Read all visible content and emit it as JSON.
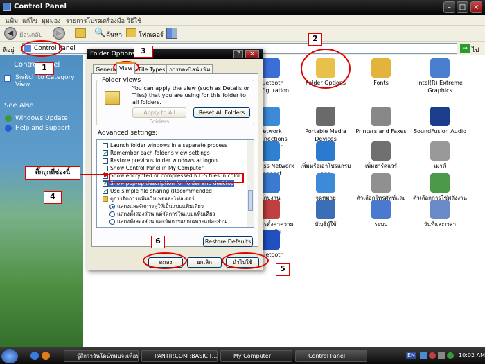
{
  "window": {
    "title": "Control Panel"
  },
  "menu": [
    "แฟ้ม",
    "แก้ไข",
    "มุมมอง",
    "รายการโปรด",
    "เครื่องมือ",
    "วิธีใช้"
  ],
  "toolbar": {
    "back": "ย้อนกลับ",
    "search": "ค้นหา",
    "folders": "โฟลเดอร์"
  },
  "address": {
    "label": "ที่อยู่",
    "value": "Control Panel",
    "go": "ไป"
  },
  "sidebar": {
    "panel_title": "Control Panel",
    "switch_view": "Switch to Category View",
    "see_also": "See Also",
    "links": [
      "Windows Update",
      "Help and Support"
    ]
  },
  "items": [
    {
      "label": "Bluetooth Configuration",
      "color": "#3a6fd8"
    },
    {
      "label": "Folder Options",
      "color": "#e8c14a"
    },
    {
      "label": "Fonts",
      "color": "#e2b43c"
    },
    {
      "label": "Intel(R) Extreme Graphics",
      "color": "#4a7fd0"
    },
    {
      "label": "Network Connections Manager",
      "color": "#3c8ad8"
    },
    {
      "label": "Portable Media Devices",
      "color": "#6a6a6a"
    },
    {
      "label": "Printers and Faxes",
      "color": "#888888"
    },
    {
      "label": "SoundFusion Audio",
      "color": "#1c3d8c"
    },
    {
      "label": "Wireless Network Connect",
      "color": "#2f80d0"
    },
    {
      "label": "เพิ่มหรือเอาโปรแกรมออก",
      "color": "#2b7ad0"
    },
    {
      "label": "เพิ่มฮาร์ดแวร์",
      "color": "#707070"
    },
    {
      "label": "เมาส์",
      "color": "#999999"
    },
    {
      "label": "แถบงาน",
      "color": "#3a7ad0"
    },
    {
      "label": "จดหมาย",
      "color": "#3d8ad8"
    },
    {
      "label": "ตัวเลือกโทรศัพท์และโมเด็ม",
      "color": "#909090"
    },
    {
      "label": "ตัวเลือกการใช้พลังงาน",
      "color": "#4a9a4a"
    },
    {
      "label": "ศูนย์การตั้งค่าความปลอดภัย",
      "color": "#c04040"
    },
    {
      "label": "บัญชีผู้ใช้",
      "color": "#3a6fb8"
    },
    {
      "label": "ระบบ",
      "color": "#4a7ad0"
    },
    {
      "label": "วันที่และเวลา",
      "color": "#6a8ac8"
    },
    {
      "label": "Bluetooth",
      "color": "#2050c0"
    }
  ],
  "dialog": {
    "title": "Folder Options",
    "tabs": [
      "General",
      "View",
      "File Types",
      "การออฟไลน์แฟ้ม"
    ],
    "folder_views_title": "Folder views",
    "folder_views_text": "You can apply the view (such as Details or Tiles) that you are using for this folder to all folders.",
    "apply_all": "Apply to All Folders",
    "reset_all": "Reset All Folders",
    "advanced_title": "Advanced settings:",
    "advanced": [
      {
        "text": "Launch folder windows in a separate process",
        "type": "check",
        "checked": false
      },
      {
        "text": "Remember each folder's view settings",
        "type": "check",
        "checked": true
      },
      {
        "text": "Restore previous folder windows at logon",
        "type": "check",
        "checked": false
      },
      {
        "text": "Show Control Panel in My Computer",
        "type": "check",
        "checked": false
      },
      {
        "text": "Show encrypted or compressed NTFS files in color",
        "type": "check",
        "checked": true
      },
      {
        "text": "Show pop-up description for folder and desktop items",
        "type": "check",
        "checked": true
      },
      {
        "text": "Use simple file sharing (Recommended)",
        "type": "check",
        "checked": true
      },
      {
        "text": "ดูการจัดการแฟ้มเว็บเพจและโฟลเดอร์",
        "type": "folder"
      },
      {
        "text": "แสดงและจัดการคู่ให้เป็นแบบแฟ้มเดียว",
        "type": "radio",
        "checked": true
      },
      {
        "text": "แสดงทั้งสองส่วน แต่จัดการในแบบแฟ้มเดียว",
        "type": "radio",
        "checked": false
      },
      {
        "text": "แสดงทั้งสองส่วน และจัดการแยกเฉพาะแต่ละส่วน",
        "type": "radio",
        "checked": false
      }
    ],
    "restore_defaults": "Restore Defaults",
    "ok": "ตกลง",
    "cancel": "ยกเลิก",
    "apply": "นำไปใช้"
  },
  "annotations": {
    "n1": "1",
    "n2": "2",
    "n3": "3",
    "n4": "4",
    "n5": "5",
    "n6": "6",
    "callout": "ติ๊กถูกที่ช่องนี้",
    "color": "#e00000"
  },
  "taskbar": {
    "tasks": [
      "รู้สึกว่าวันโดน์ทพบจะเพื่อนะ...",
      "PANTIP.COM :BASIC [...]",
      "My Computer",
      "Control Panel"
    ],
    "lang": "EN",
    "time": "10:02 AM"
  }
}
